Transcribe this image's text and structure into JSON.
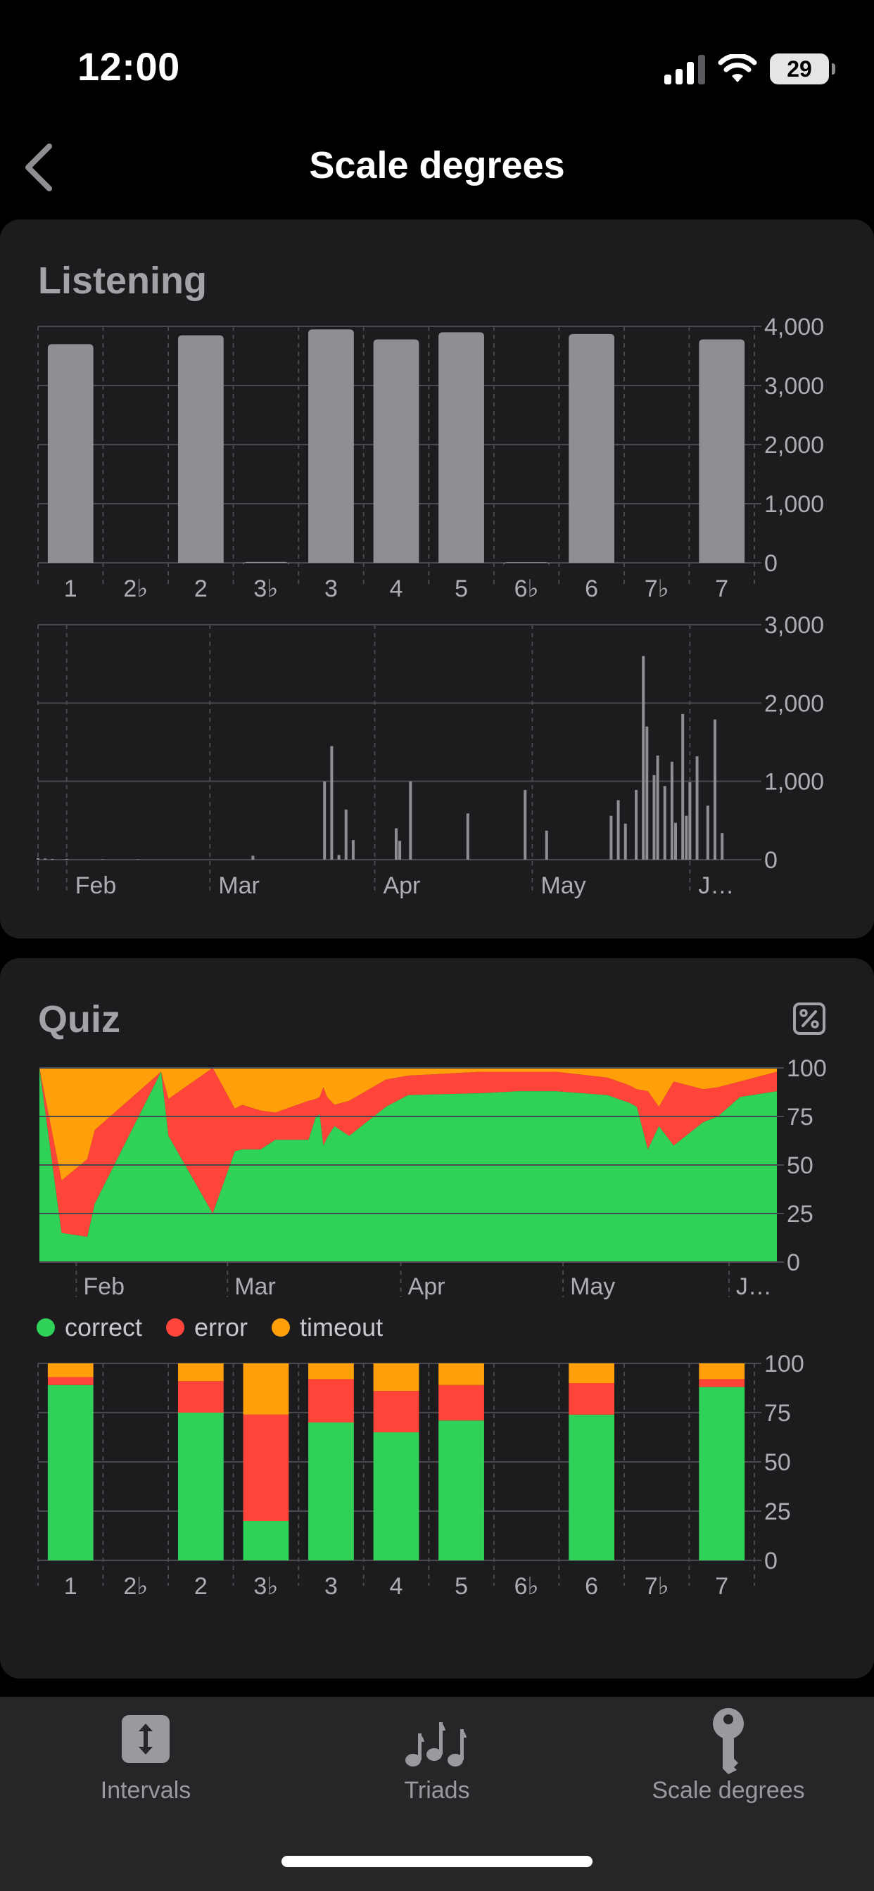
{
  "status": {
    "time": "12:00",
    "battery": "29"
  },
  "nav": {
    "title": "Scale degrees"
  },
  "listening": {
    "title": "Listening",
    "degrees_chart": {
      "type": "bar",
      "categories": [
        "1",
        "2♭",
        "2",
        "3♭",
        "3",
        "4",
        "5",
        "6♭",
        "6",
        "7♭",
        "7"
      ],
      "values": [
        3700,
        0,
        3850,
        15,
        3950,
        3780,
        3900,
        10,
        3870,
        0,
        3780
      ],
      "yticks": [
        "4,000",
        "3,000",
        "2,000",
        "1,000",
        "0"
      ],
      "ylim": [
        0,
        4000
      ]
    },
    "timeline_chart": {
      "type": "bar",
      "xticks": [
        "Feb",
        "Mar",
        "Apr",
        "May",
        "J…"
      ],
      "yticks": [
        "3,000",
        "2,000",
        "1,000",
        "0"
      ],
      "ylim": [
        0,
        3000
      ],
      "x": [
        0.0,
        0.01,
        0.02,
        0.04,
        0.09,
        0.14,
        0.3,
        0.4,
        0.41,
        0.42,
        0.43,
        0.44,
        0.45,
        0.46,
        0.47,
        0.48,
        0.5,
        0.505,
        0.51,
        0.52,
        0.6,
        0.68,
        0.71,
        0.8,
        0.81,
        0.82,
        0.835,
        0.845,
        0.85,
        0.86,
        0.865,
        0.87,
        0.875,
        0.885,
        0.89,
        0.9,
        0.905,
        0.91,
        0.92,
        0.925,
        0.935,
        0.945,
        0.955,
        0.96,
        0.97
      ],
      "values": [
        20,
        15,
        10,
        10,
        5,
        5,
        50,
        1000,
        1450,
        60,
        640,
        250,
        0,
        0,
        0,
        0,
        400,
        240,
        0,
        1000,
        590,
        890,
        370,
        560,
        760,
        460,
        890,
        2600,
        1700,
        1080,
        1330,
        0,
        940,
        1250,
        470,
        1860,
        560,
        990,
        1320,
        0,
        690,
        1790,
        340,
        0,
        0
      ]
    }
  },
  "quiz": {
    "title": "Quiz",
    "pct_icon": "percent-square-icon",
    "timeline_chart": {
      "type": "area",
      "xticks": [
        "Feb",
        "Mar",
        "Apr",
        "May",
        "J…"
      ],
      "yticks": [
        "100",
        "75",
        "50",
        "25",
        "0"
      ],
      "ylim": [
        0,
        100
      ],
      "x": [
        0.0,
        0.03,
        0.065,
        0.075,
        0.165,
        0.175,
        0.235,
        0.265,
        0.275,
        0.3,
        0.32,
        0.365,
        0.375,
        0.38,
        0.385,
        0.39,
        0.4,
        0.42,
        0.47,
        0.5,
        0.6,
        0.65,
        0.7,
        0.77,
        0.8,
        0.81,
        0.825,
        0.84,
        0.86,
        0.9,
        0.92,
        0.95,
        1.0
      ],
      "series": [
        {
          "name": "correct",
          "values": [
            100,
            15,
            13,
            30,
            98,
            65,
            25,
            57,
            58,
            58,
            63,
            63,
            75,
            76,
            60,
            64,
            70,
            65,
            80,
            86,
            87,
            88,
            88,
            86,
            82,
            80,
            58,
            70,
            60,
            72,
            75,
            85,
            88
          ]
        },
        {
          "name": "error",
          "values": [
            0,
            27,
            40,
            38,
            0,
            19,
            75,
            22,
            23,
            20,
            14,
            20,
            9,
            9,
            30,
            21,
            11,
            18,
            14,
            10,
            11,
            10,
            10,
            9,
            9,
            9,
            30,
            10,
            33,
            17,
            15,
            8,
            10
          ]
        },
        {
          "name": "timeout",
          "values": [
            0,
            58,
            47,
            32,
            2,
            16,
            0,
            21,
            19,
            22,
            23,
            17,
            16,
            15,
            10,
            15,
            19,
            17,
            6,
            4,
            2,
            2,
            2,
            5,
            9,
            11,
            12,
            20,
            7,
            11,
            10,
            7,
            2
          ]
        }
      ]
    },
    "legend": [
      {
        "label": "correct",
        "color": "#30d158"
      },
      {
        "label": "error",
        "color": "#ff453a"
      },
      {
        "label": "timeout",
        "color": "#ff9f0a"
      }
    ],
    "degrees_chart": {
      "type": "bar",
      "categories": [
        "1",
        "2♭",
        "2",
        "3♭",
        "3",
        "4",
        "5",
        "6♭",
        "6",
        "7♭",
        "7"
      ],
      "yticks": [
        "100",
        "75",
        "50",
        "25",
        "0"
      ],
      "ylim": [
        0,
        100
      ],
      "series": [
        {
          "name": "correct",
          "values": [
            89,
            0,
            75,
            20,
            70,
            65,
            71,
            0,
            74,
            0,
            88
          ]
        },
        {
          "name": "error",
          "values": [
            4,
            0,
            16,
            54,
            22,
            21,
            18,
            0,
            16,
            0,
            4
          ]
        },
        {
          "name": "timeout",
          "values": [
            7,
            0,
            9,
            26,
            8,
            14,
            11,
            0,
            10,
            0,
            8
          ]
        }
      ]
    }
  },
  "colors": {
    "correct": "#30d158",
    "error": "#ff453a",
    "timeout": "#ff9f0a",
    "bar_gray": "#8e8e93",
    "grid": "#4a4a4e",
    "axis_text": "#aeaeb2"
  },
  "tabs": [
    {
      "label": "Intervals",
      "icon": "arrows-updown-icon"
    },
    {
      "label": "Triads",
      "icon": "music-notes-icon"
    },
    {
      "label": "Scale degrees",
      "icon": "key-icon"
    }
  ]
}
